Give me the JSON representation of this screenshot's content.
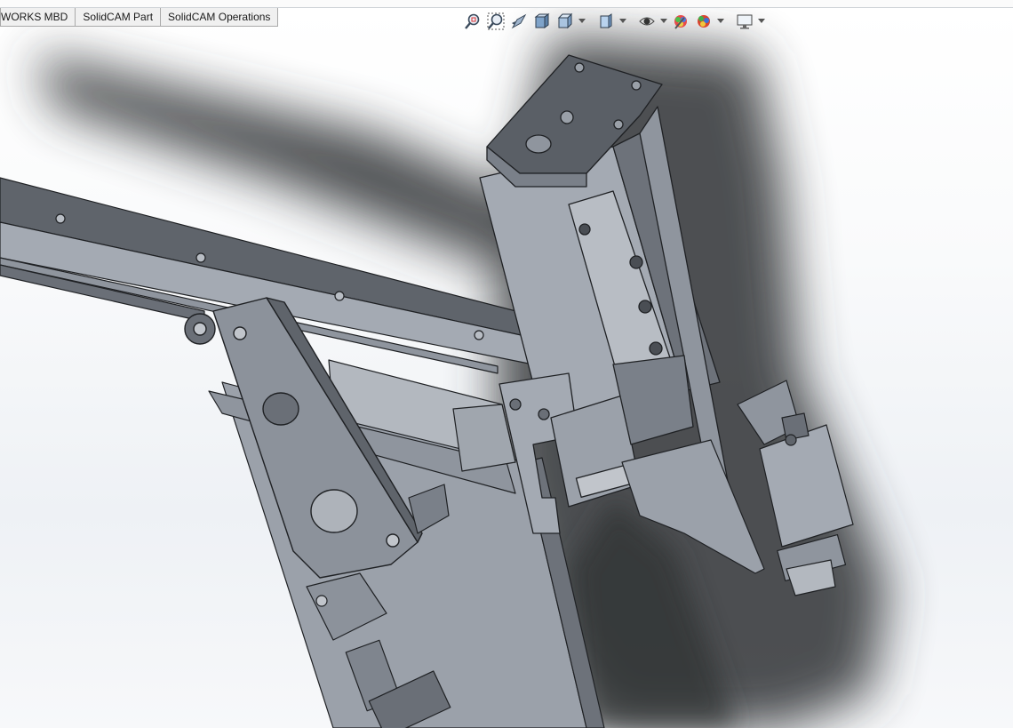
{
  "tabs": [
    {
      "label": "WORKS MBD"
    },
    {
      "label": "SolidCAM Part"
    },
    {
      "label": "SolidCAM Operations"
    }
  ],
  "heads_up_toolbar": {
    "items": [
      {
        "icon": "zoom-to-fit-icon"
      },
      {
        "icon": "zoom-to-area-icon"
      },
      {
        "icon": "previous-view-icon"
      },
      {
        "icon": "section-view-icon"
      },
      {
        "icon": "view-orientation-icon",
        "dropdown": true
      },
      {
        "icon": "display-style-icon",
        "dropdown": true
      },
      {
        "icon": "hide-show-items-icon",
        "dropdown": true
      },
      {
        "icon": "edit-appearance-icon"
      },
      {
        "icon": "apply-scene-icon",
        "dropdown": true
      },
      {
        "icon": "view-settings-icon",
        "dropdown": true
      }
    ]
  },
  "colors": {
    "part_light": "#aab0b9",
    "part_mid": "#8f959e",
    "part_dark": "#5f646b",
    "part_darker": "#4a4e54",
    "shadow": "#3b3d41",
    "edge": "#1f2124"
  }
}
